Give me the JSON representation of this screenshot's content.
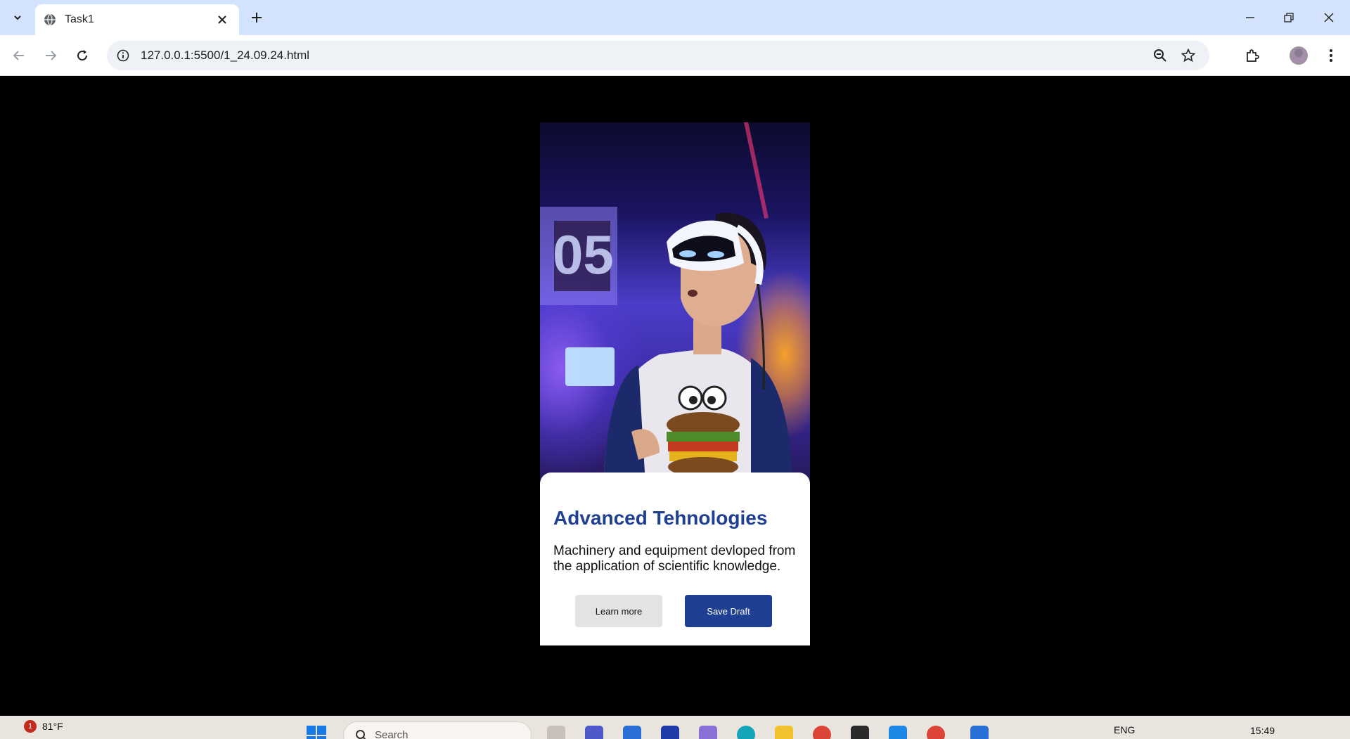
{
  "browser": {
    "tab_title": "Task1",
    "url": "127.0.0.1:5500/1_24.09.24.html"
  },
  "card": {
    "title": "Advanced Tehnologies",
    "text": "Machinery and equipment devloped from the application of scientific knowledge.",
    "learn_label": "Learn more",
    "save_label": "Save Draft",
    "accent_color": "#1f3f93",
    "image_subject": "vr-headset-person-photo"
  },
  "taskbar": {
    "weather_badge": "1",
    "temperature": "81°F",
    "search_placeholder": "Search",
    "language": "ENG",
    "time": "15:49"
  }
}
